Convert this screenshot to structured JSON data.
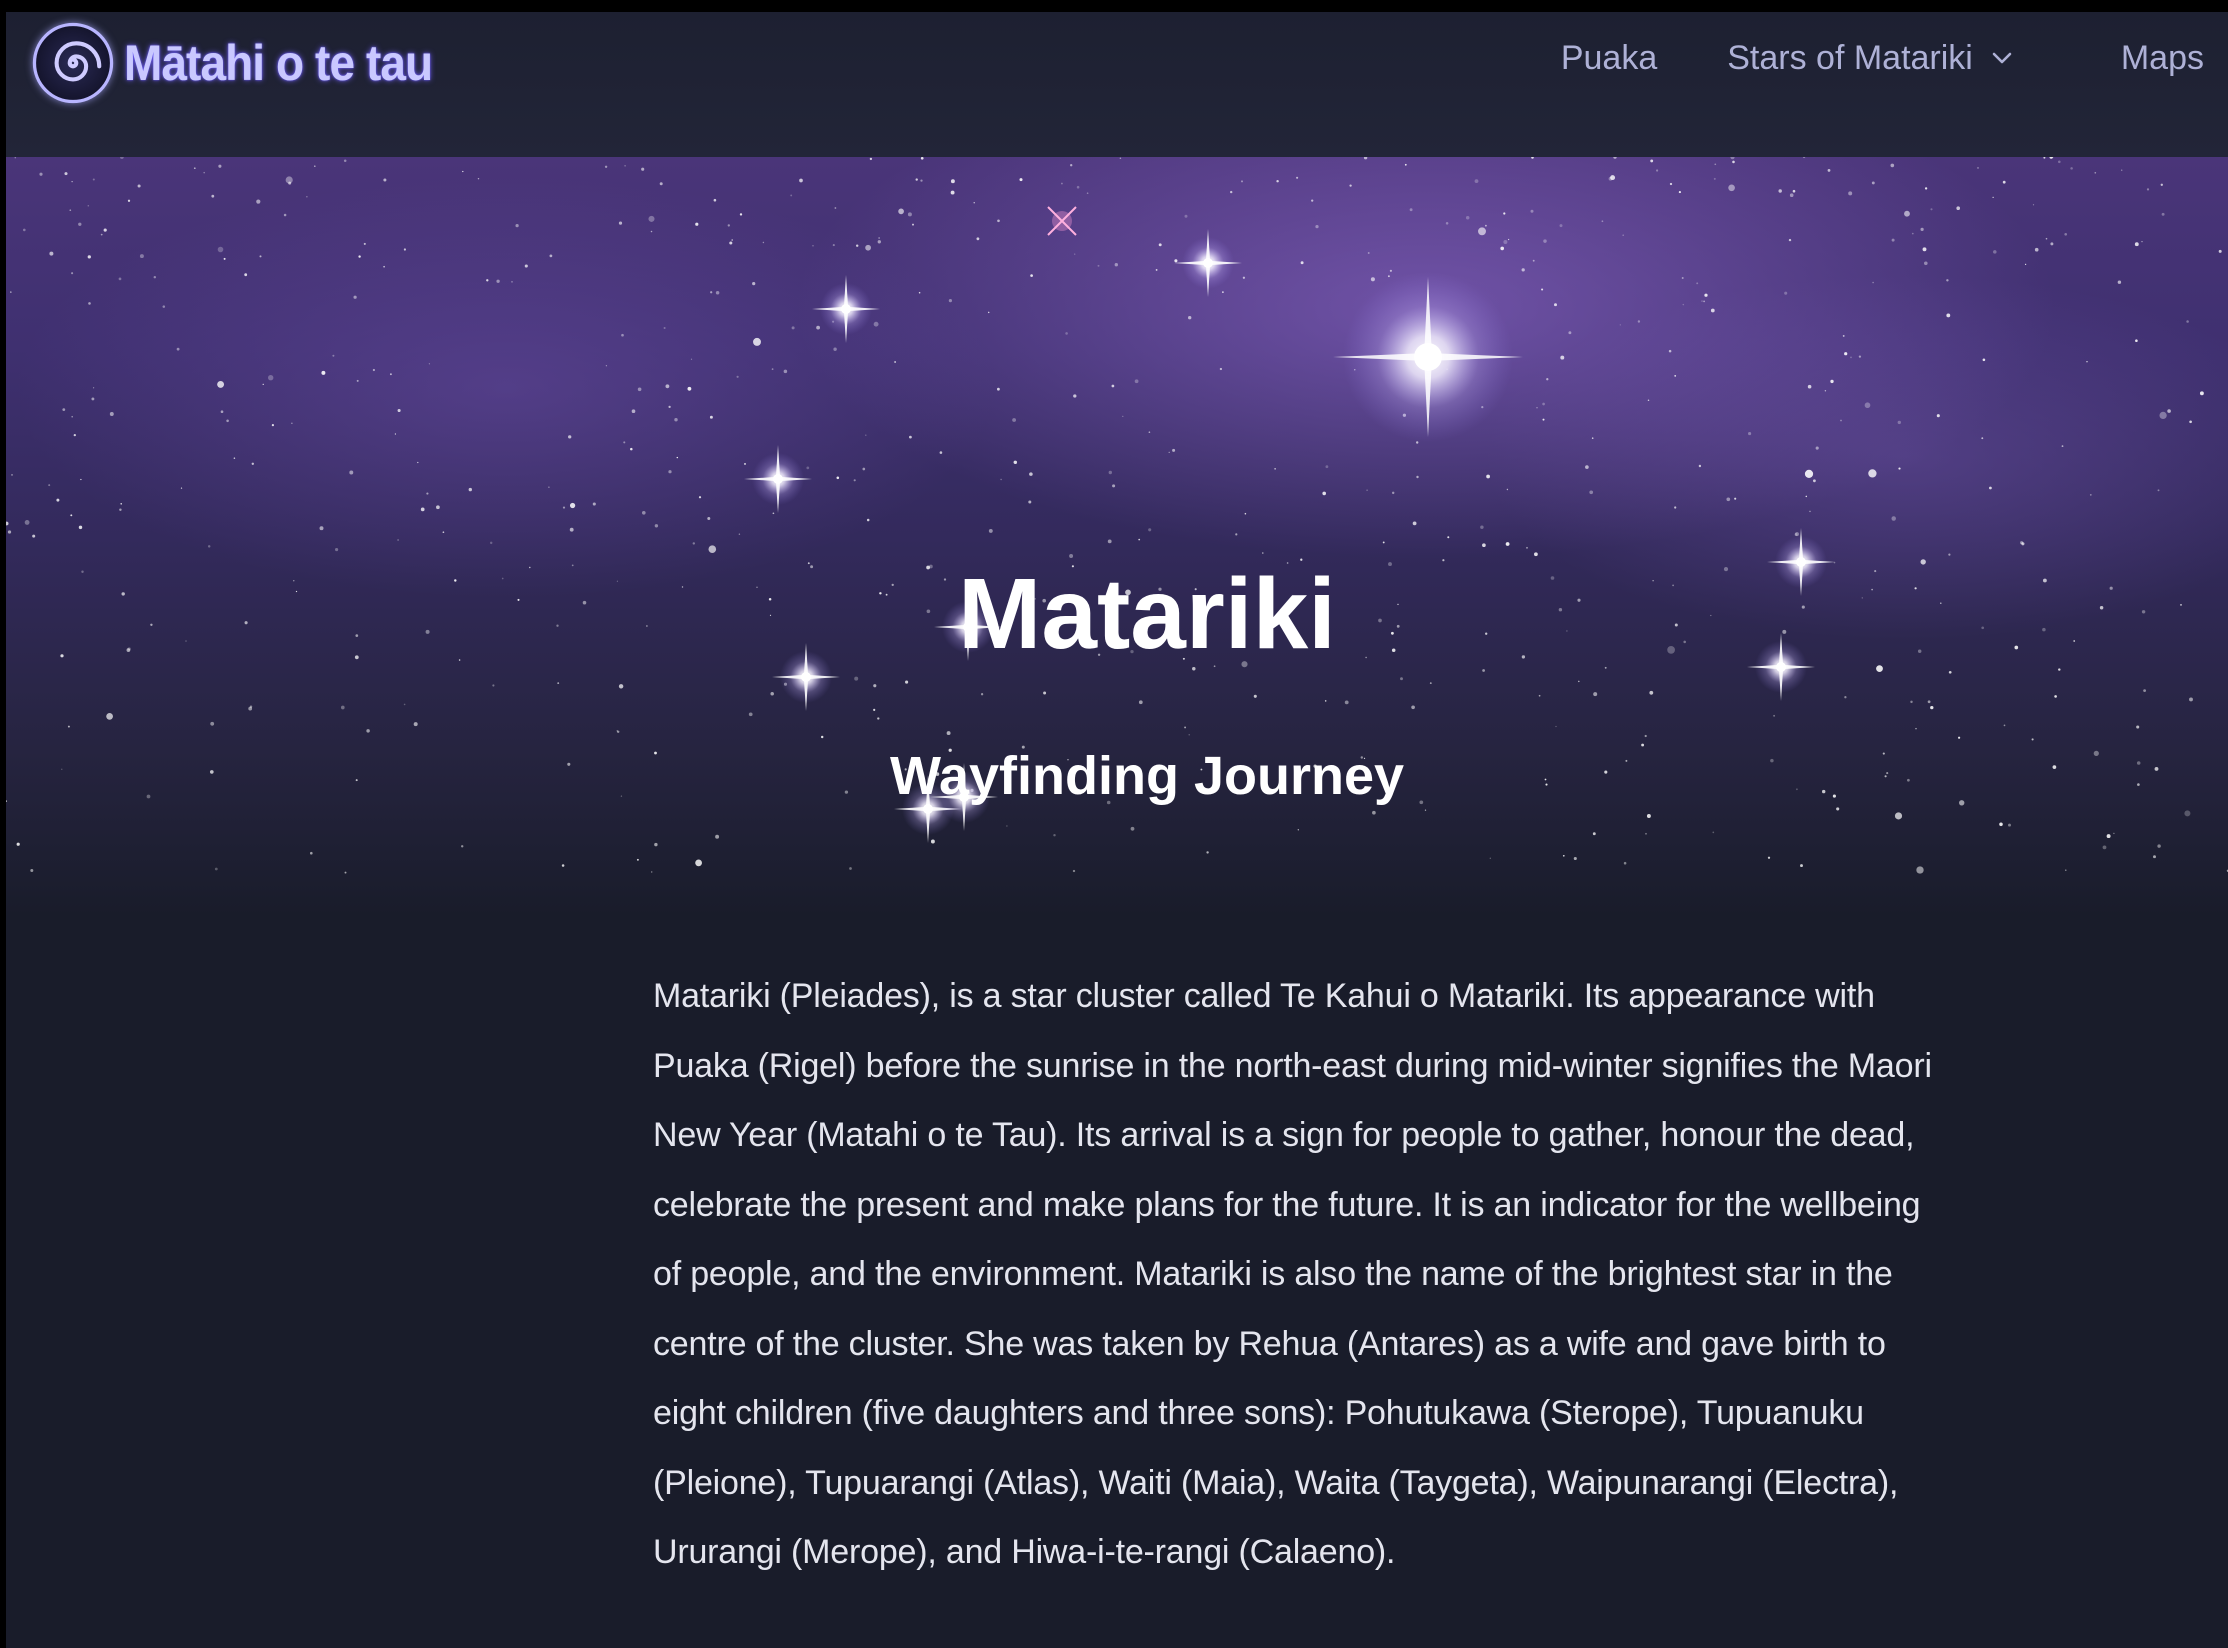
{
  "navbar": {
    "brand": "Mātahi o te tau",
    "links": [
      {
        "label": "Puaka"
      },
      {
        "label": "Stars of Matariki",
        "has_dropdown": true
      },
      {
        "label": "Maps"
      }
    ]
  },
  "hero": {
    "title": "Matariki",
    "subtitle": "Wayfinding Journey"
  },
  "content": {
    "paragraph": "Matariki (Pleiades), is a star cluster called Te Kahui o Matariki. Its appearance with Puaka (Rigel) before the sunrise in the north-east during mid-winter signifies the Maori New Year (Matahi o te Tau). Its arrival is a sign for people to gather, honour the dead, celebrate the present and make plans for the future. It is an indicator for the wellbeing of people, and the environment. Matariki is also the name of the brightest star in the centre of the cluster. She was taken by Rehua (Antares) as a wife and gave birth to eight children (five daughters and three sons): Pohutukawa (Sterope), Tupuanuku (Pleione), Tupuarangi (Atlas), Waiti (Maia), Waita (Taygeta), Waipunarangi (Electra), Ururangi (Merope), and Hiwa-i-te-rangi (Calaeno)."
  },
  "icons": {
    "logo": "spiral-logo-icon",
    "dropdown": "chevron-down-icon"
  },
  "colors": {
    "background": "#191c2a",
    "navbar": "#1f2233",
    "nav_text": "#aeb1d6",
    "brand_text": "#c9c8ff",
    "hero_purple": "#4a3579",
    "body_text": "#e4e5ee"
  }
}
